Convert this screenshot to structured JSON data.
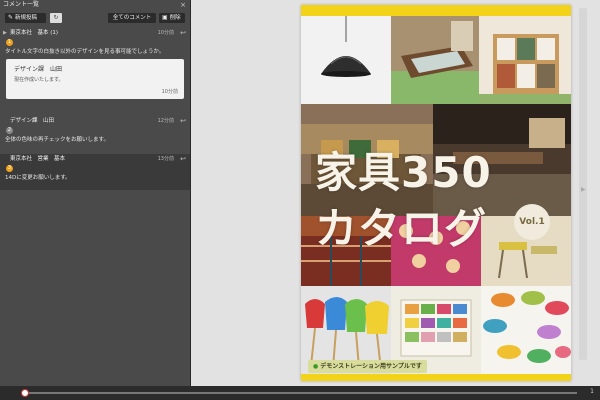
{
  "panel": {
    "title": "コメント一覧",
    "close_icon": "×",
    "toolbar": {
      "new_post": "新規投稿",
      "all_comments": "全てのコメント",
      "delete": "削除"
    }
  },
  "threads": [
    {
      "author": "東京本社　基本 (1)",
      "date": "10分前",
      "badge": "1",
      "badge_color": "#f0a21c",
      "text": "タイトル文字の白抜き以外のデザインを見る事可能でしょうか。",
      "reply": {
        "author": "デザイン課　山田",
        "text": "現在作成いたします。",
        "date": "10分前"
      }
    },
    {
      "author": "デザイン課　山田",
      "date": "12分前",
      "badge": "2",
      "badge_color": "#8a8a8a",
      "text": "全体の色味の再チェックをお願いします。"
    },
    {
      "author": "東京本社　営業　基本",
      "date": "13分前",
      "badge": "3",
      "badge_color": "#f0a21c",
      "text": "14Dに変更お願いします。"
    }
  ],
  "cover": {
    "title_line1": "家具350",
    "title_line2": "カタログ",
    "vol": "Vol.1",
    "demo_label": "デモンストレーション用サンプルです",
    "accent_yellow": "#f3d21a"
  },
  "bottom": {
    "page_count": "1",
    "position": 0
  }
}
